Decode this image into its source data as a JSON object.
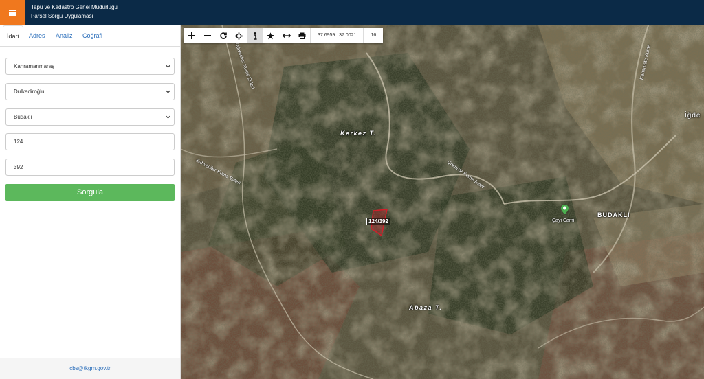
{
  "header": {
    "title_line1": "Tapu ve Kadastro Genel Müdürlüğü",
    "title_line2": "Parsel Sorgu Uygulaması",
    "menu_icon": "hamburger-icon",
    "accent_color": "#f0781e",
    "bar_color": "#0b2a47"
  },
  "tabs": [
    {
      "label": "İdari",
      "active": true
    },
    {
      "label": "Adres",
      "active": false
    },
    {
      "label": "Analiz",
      "active": false
    },
    {
      "label": "Coğrafi",
      "active": false
    }
  ],
  "form": {
    "province": "Kahramanmaraş",
    "district": "Dulkadiroğlu",
    "neighborhood": "Budaklı",
    "block": "124",
    "parcel": "392",
    "submit_label": "Sorgula",
    "submit_color": "#5cb85c"
  },
  "footer": {
    "email": "cbs@tkgm.gov.tr"
  },
  "map": {
    "coordinates": "37.6959 : 37.0021",
    "zoom_level": "16",
    "toolbar_icons": [
      "zoom-in-icon",
      "zoom-out-icon",
      "refresh-icon",
      "locate-icon",
      "info-icon",
      "star-icon",
      "measure-icon",
      "print-icon"
    ],
    "labels": {
      "kerkez": "Kerkez T.",
      "abaza": "Abaza T.",
      "budakli": "BUDAKLI",
      "igde": "İğde",
      "cami": "Çayi Cami",
      "parcel": "124/392",
      "road1": "Kahveciler Kume Evleri",
      "road2": "Kahveciler Kume Evleri",
      "road3": "Çukurlar Kume Evler",
      "road4": "Kenaruste Kume"
    }
  }
}
